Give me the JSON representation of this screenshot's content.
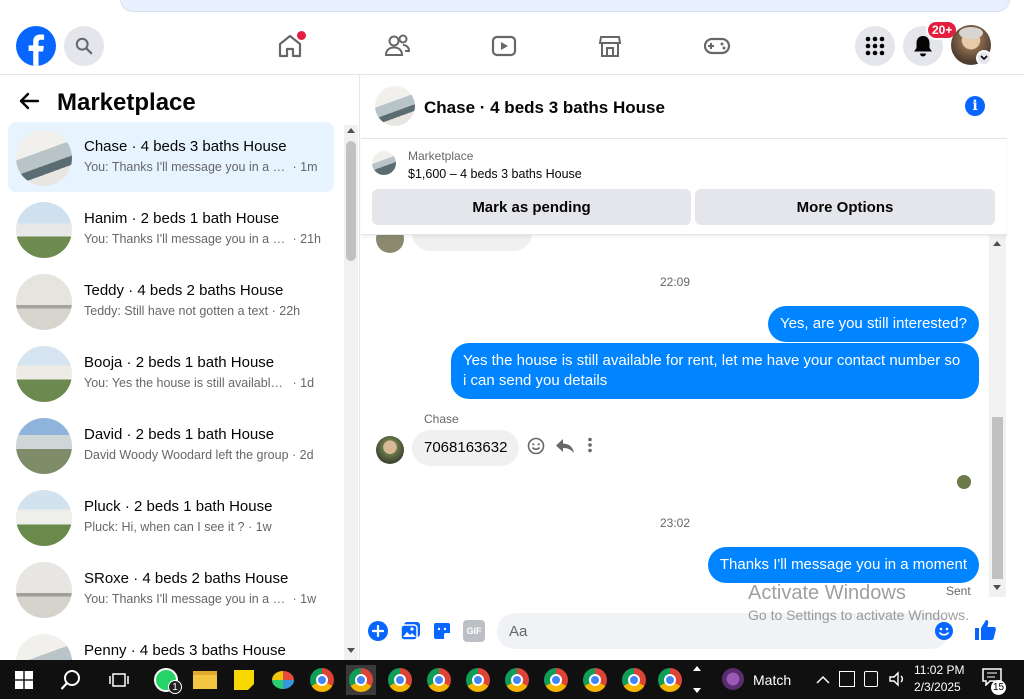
{
  "sidebar": {
    "title": "Marketplace",
    "conversations": [
      {
        "title": "Chase · 4 beds 3 baths House",
        "preview": "You: Thanks I'll message you in a moment",
        "time": "· 1m"
      },
      {
        "title": "Hanim · 2 beds 1 bath House",
        "preview": "You: Thanks I'll message you in a moment",
        "time": "· 21h"
      },
      {
        "title": "Teddy · 4 beds 2 baths House",
        "preview": "Teddy: Still have not gotten a text",
        "time": "· 22h"
      },
      {
        "title": "Booja · 2 beds 1 bath House",
        "preview": "You: Yes the house is still available for rent",
        "time": "· 1d"
      },
      {
        "title": "David · 2 beds 1 bath House",
        "preview": "David Woody Woodard left the group",
        "time": "· 2d"
      },
      {
        "title": "Pluck · 2 beds 1 bath House",
        "preview": "Pluck: Hi, when can I see it ?",
        "time": "· 1w"
      },
      {
        "title": "SRoxe · 4 beds 2 baths House",
        "preview": "You: Thanks I'll message you in a moment",
        "time": "· 1w"
      },
      {
        "title": "Penny · 4 beds 3 baths House",
        "preview": "",
        "time": ""
      }
    ]
  },
  "header": {
    "notification_badge": "20+"
  },
  "chat": {
    "title": "Chase · 4 beds 3 baths House",
    "listing": {
      "source": "Marketplace",
      "price_title": "$1,600 – 4 beds 3 baths House",
      "mark_pending_label": "Mark as pending",
      "more_options_label": "More Options"
    },
    "time_1": "22:09",
    "msg_out_1": "Yes, are you still interested?",
    "msg_out_2": "Yes the house is still available for rent, let me have your contact number so i can send you details",
    "sender_name": "Chase",
    "msg_in_1": "7068163632",
    "time_2": "23:02",
    "msg_out_3": "Thanks I'll message you in a moment",
    "sent_status": "Sent",
    "composer_placeholder": "Aa"
  },
  "watermark": {
    "line1": "Activate Windows",
    "line2": "Go to Settings to activate Windows."
  },
  "taskbar": {
    "whatsapp_badge": "1",
    "weather_label": "Match",
    "time": "11:02 PM",
    "date": "2/3/2025",
    "notification_count": "15"
  },
  "colors": {
    "fb_blue": "#0866ff",
    "bubble_blue": "#0084ff",
    "badge_red": "#e41e3f"
  }
}
